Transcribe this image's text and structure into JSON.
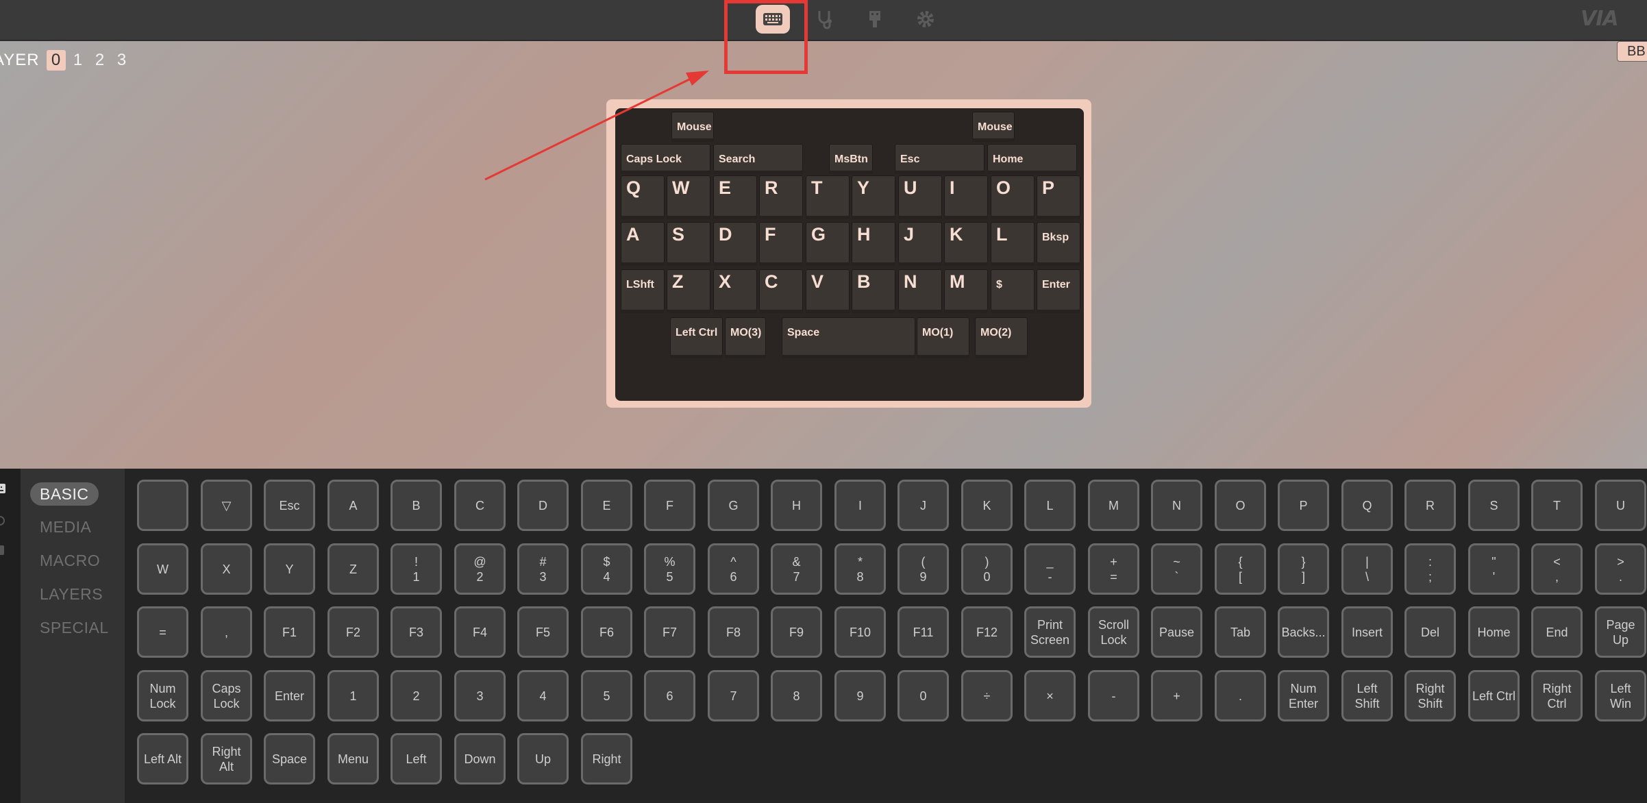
{
  "topbar": {
    "icons": [
      "keyboard-icon",
      "stethoscope-icon",
      "usb-device-icon",
      "gear-icon"
    ],
    "logo": "VIA"
  },
  "layers": {
    "label": "AYER",
    "items": [
      "0",
      "1",
      "2",
      "3"
    ],
    "active": "0"
  },
  "right_tab_label": "BB",
  "keyboard": {
    "keys": [
      {
        "label": "Mouse Btn",
        "size": "small"
      },
      {
        "label": "Mouse Btn",
        "size": "small"
      },
      {
        "label": "Caps Lock",
        "size": "small"
      },
      {
        "label": "Search",
        "size": "small"
      },
      {
        "label": "MsBtn",
        "size": "small"
      },
      {
        "label": "Esc",
        "size": "small"
      },
      {
        "label": "Home",
        "size": "small"
      },
      {
        "label": "Q",
        "size": "big"
      },
      {
        "label": "W",
        "size": "big"
      },
      {
        "label": "E",
        "size": "big"
      },
      {
        "label": "R",
        "size": "big"
      },
      {
        "label": "T",
        "size": "big"
      },
      {
        "label": "Y",
        "size": "big"
      },
      {
        "label": "U",
        "size": "big"
      },
      {
        "label": "I",
        "size": "big"
      },
      {
        "label": "O",
        "size": "big"
      },
      {
        "label": "P",
        "size": "big"
      },
      {
        "label": "A",
        "size": "big"
      },
      {
        "label": "S",
        "size": "big"
      },
      {
        "label": "D",
        "size": "big"
      },
      {
        "label": "F",
        "size": "big"
      },
      {
        "label": "G",
        "size": "big"
      },
      {
        "label": "H",
        "size": "big"
      },
      {
        "label": "J",
        "size": "big"
      },
      {
        "label": "K",
        "size": "big"
      },
      {
        "label": "L",
        "size": "big"
      },
      {
        "label": "Bksp",
        "size": "small"
      },
      {
        "label": "LShft",
        "size": "small"
      },
      {
        "label": "Z",
        "size": "big"
      },
      {
        "label": "X",
        "size": "big"
      },
      {
        "label": "C",
        "size": "big"
      },
      {
        "label": "V",
        "size": "big"
      },
      {
        "label": "B",
        "size": "big"
      },
      {
        "label": "N",
        "size": "big"
      },
      {
        "label": "M",
        "size": "big"
      },
      {
        "label": "$",
        "size": "small"
      },
      {
        "label": "Enter",
        "size": "small"
      },
      {
        "label": "Left Ctrl",
        "size": "small"
      },
      {
        "label": "MO(3)",
        "size": "small"
      },
      {
        "label": "Space",
        "size": "small"
      },
      {
        "label": "MO(1)",
        "size": "small"
      },
      {
        "label": "MO(2)",
        "size": "small"
      }
    ]
  },
  "categories": {
    "items": [
      "BASIC",
      "MEDIA",
      "MACRO",
      "LAYERS",
      "SPECIAL"
    ],
    "active": "BASIC"
  },
  "palette": {
    "rows": [
      [
        "",
        "▽",
        "Esc",
        "A",
        "B",
        "C",
        "D",
        "E",
        "F",
        "G",
        "H",
        "I",
        "J",
        "K",
        "L",
        "M",
        "N",
        "O",
        "P",
        "Q",
        "R",
        "S",
        "T",
        "U"
      ],
      [
        "W",
        "X",
        "Y",
        "Z",
        "!\n1",
        "@\n2",
        "#\n3",
        "$\n4",
        "%\n5",
        "^\n6",
        "&\n7",
        "*\n8",
        "(\n9",
        ")\n0",
        "_\n-",
        "+\n=",
        "~\n`",
        "{\n[",
        "}\n]",
        "|\n\\",
        ":\n;",
        "\"\n'",
        "<\n,",
        ">\n."
      ],
      [
        "=",
        ",",
        "F1",
        "F2",
        "F3",
        "F4",
        "F5",
        "F6",
        "F7",
        "F8",
        "F9",
        "F10",
        "F11",
        "F12",
        "Print\nScreen",
        "Scroll\nLock",
        "Pause",
        "Tab",
        "Backs...",
        "Insert",
        "Del",
        "Home",
        "End",
        "Page\nUp"
      ],
      [
        "Num\nLock",
        "Caps\nLock",
        "Enter",
        "1",
        "2",
        "3",
        "4",
        "5",
        "6",
        "7",
        "8",
        "9",
        "0",
        "÷",
        "×",
        "-",
        "+",
        ".",
        "Num\nEnter",
        "Left\nShift",
        "Right\nShift",
        "Left Ctrl",
        "Right\nCtrl",
        "Left\nWin"
      ],
      [
        "Left Alt",
        "Right\nAlt",
        "Space",
        "Menu",
        "Left",
        "Down",
        "Up",
        "Right"
      ]
    ]
  },
  "colors": {
    "accent": "#f1ccbd",
    "annotation": "#e53935",
    "key_cap": "#3c3633",
    "key_legend": "#f6ded2"
  }
}
